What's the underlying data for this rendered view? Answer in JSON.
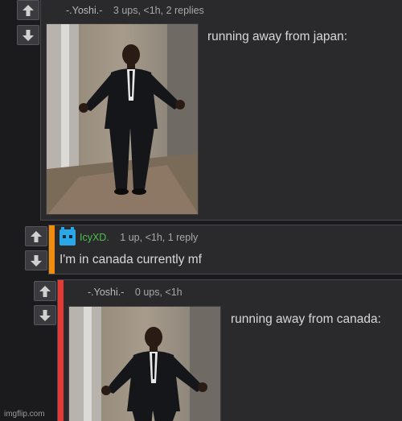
{
  "comments": [
    {
      "username": "-.Yoshi.-",
      "info": "3 ups, <1h, 2 replies",
      "text": "running away from japan:"
    },
    {
      "username": "IcyXD.",
      "info": "1 up, <1h, 1 reply",
      "text": "I'm in canada currently mf"
    },
    {
      "username": "-.Yoshi.-",
      "info": "0 ups, <1h",
      "text": "running away from canada:"
    }
  ],
  "watermark": "imgflip.com",
  "icons": {
    "upvote": "arrow-up-icon",
    "downvote": "arrow-down-icon",
    "avatar": "pixel-creature-avatar-icon",
    "image": "man-in-suit-meme-image"
  },
  "colors": {
    "reply_accent_orange": "#f28c0f",
    "reply_accent_red": "#e53a35",
    "username_green": "#4cc04a",
    "avatar_blue": "#2aa7e6"
  }
}
